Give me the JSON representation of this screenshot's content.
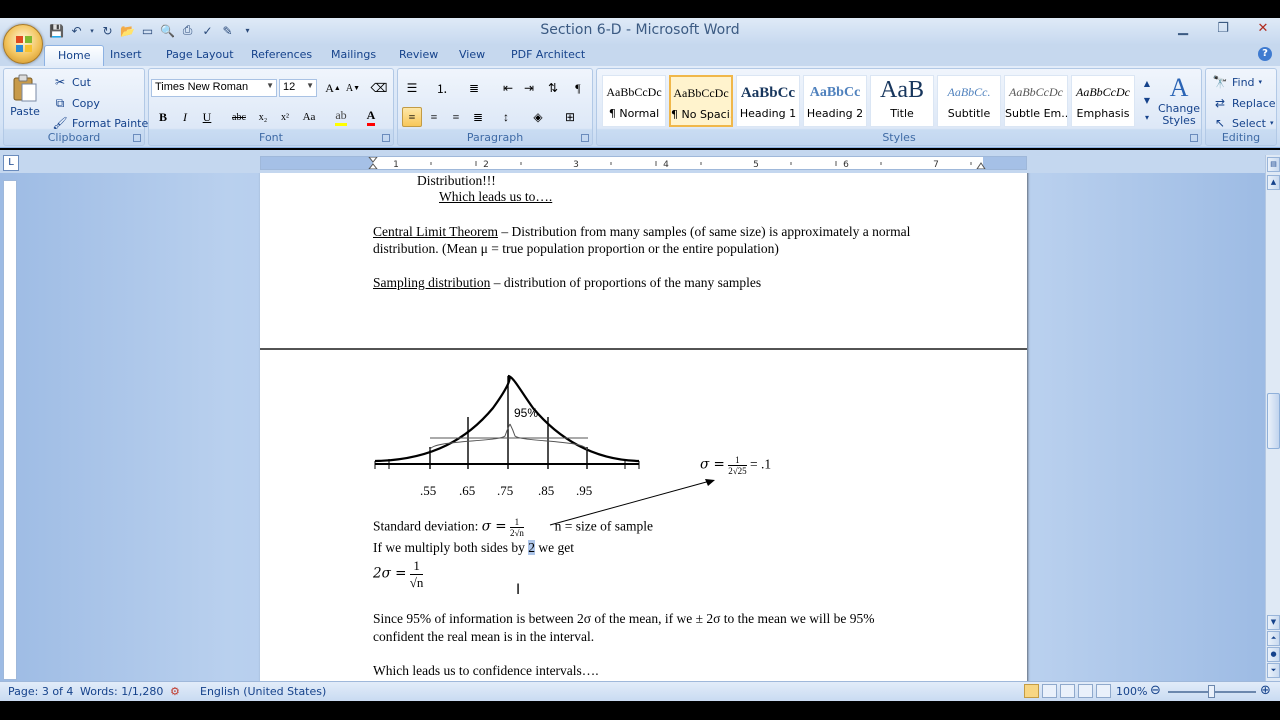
{
  "window": {
    "title": "Section 6-D - Microsoft Word"
  },
  "ribbon": {
    "tabs": [
      "Home",
      "Insert",
      "Page Layout",
      "References",
      "Mailings",
      "Review",
      "View",
      "PDF Architect"
    ],
    "clipboard": {
      "label": "Clipboard",
      "paste": "Paste",
      "cut": "Cut",
      "copy": "Copy",
      "format_painter": "Format Painter"
    },
    "font": {
      "label": "Font",
      "name": "Times New Roman",
      "size": "12"
    },
    "paragraph": {
      "label": "Paragraph"
    },
    "styles": {
      "label": "Styles",
      "items": [
        {
          "sample": "AaBbCcDc",
          "name": "¶ Normal"
        },
        {
          "sample": "AaBbCcDc",
          "name": "¶ No Spaci..."
        },
        {
          "sample": "AaBbCc",
          "name": "Heading 1"
        },
        {
          "sample": "AaBbCc",
          "name": "Heading 2"
        },
        {
          "sample": "AaB",
          "name": "Title"
        },
        {
          "sample": "AaBbCc.",
          "name": "Subtitle"
        },
        {
          "sample": "AaBbCcDc",
          "name": "Subtle Em..."
        },
        {
          "sample": "AaBbCcDc",
          "name": "Emphasis"
        }
      ],
      "change_styles": "Change Styles"
    },
    "editing": {
      "label": "Editing",
      "find": "Find",
      "replace": "Replace",
      "select": "Select"
    }
  },
  "document": {
    "page1": {
      "line1": "Distribution!!!",
      "line2": "Which leads us to….",
      "clt_term": "Central Limit Theorem",
      "clt_def1": " – Distribution from many samples (of same size) is approximately a normal",
      "clt_def2": "distribution.  (Mean μ = true population proportion or the entire population)",
      "sd_term": "Sampling distribution",
      "sd_def": " – distribution of proportions of the many samples"
    },
    "page2": {
      "curve_label": "95%",
      "axis_ticks": [
        ".55",
        ".65",
        ".75",
        ".85",
        ".95"
      ],
      "sigma_lhs": "σ =",
      "sigma_num": "1",
      "sigma_den": "2√25",
      "sigma_rhs": "= .1",
      "stdev_label": "Standard deviation: ",
      "stdev_lhs": "σ =",
      "stdev_num": "1",
      "stdev_den": "2√n",
      "n_def": "n = size of sample",
      "multiply_pre": "If we multiply both sides by ",
      "multiply_sel": "2",
      "multiply_post": " we get",
      "two_sigma_lhs": "2σ =",
      "two_sigma_num": "1",
      "two_sigma_den": "√n",
      "since1": "Since 95% of information is between 2σ of the mean, if we ± 2σ to the mean we will be 95%",
      "since2": "confident the real mean is in the interval.",
      "leads": "Which leads us to confidence intervals…."
    }
  },
  "status": {
    "page": "Page: 3 of 4",
    "words": "Words: 1/1,280",
    "language": "English (United States)",
    "zoom": "100%"
  }
}
